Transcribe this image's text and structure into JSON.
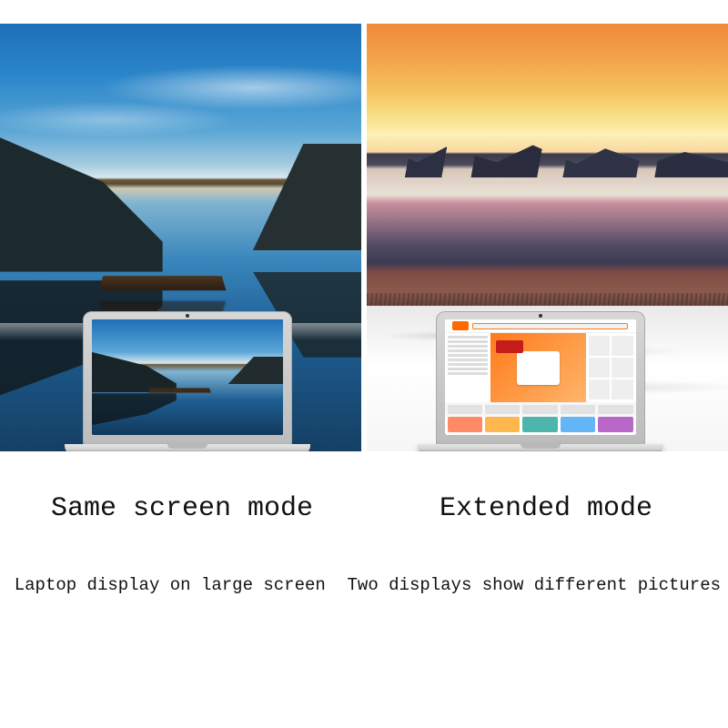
{
  "left": {
    "title": "Same screen mode",
    "description": "Laptop display on large screen"
  },
  "right": {
    "title": "Extended mode",
    "description": "Two displays show different pictures"
  }
}
